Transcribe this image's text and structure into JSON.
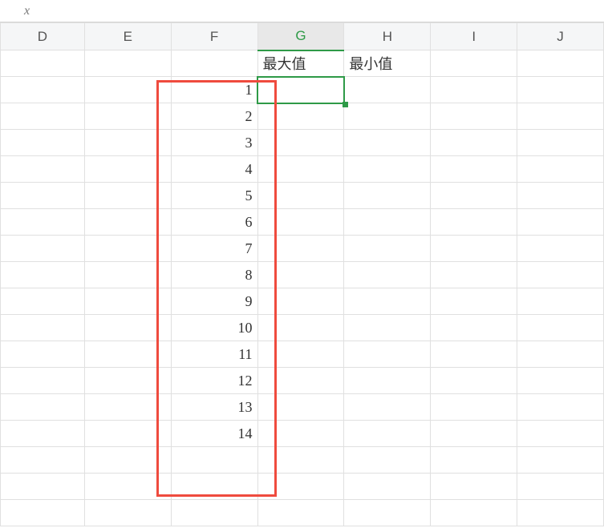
{
  "fx_label": "x",
  "columns": [
    "D",
    "E",
    "F",
    "G",
    "H",
    "I",
    "J"
  ],
  "active_column": "G",
  "header_labels": {
    "G": "最大值",
    "H": "最小值"
  },
  "f_values": [
    1,
    2,
    3,
    4,
    5,
    6,
    7,
    8,
    9,
    10,
    11,
    12,
    13,
    14
  ],
  "active_cell": {
    "col": "G",
    "row": 2
  },
  "colors": {
    "accent": "#2e9a47",
    "annotation": "#ef4b3e"
  }
}
